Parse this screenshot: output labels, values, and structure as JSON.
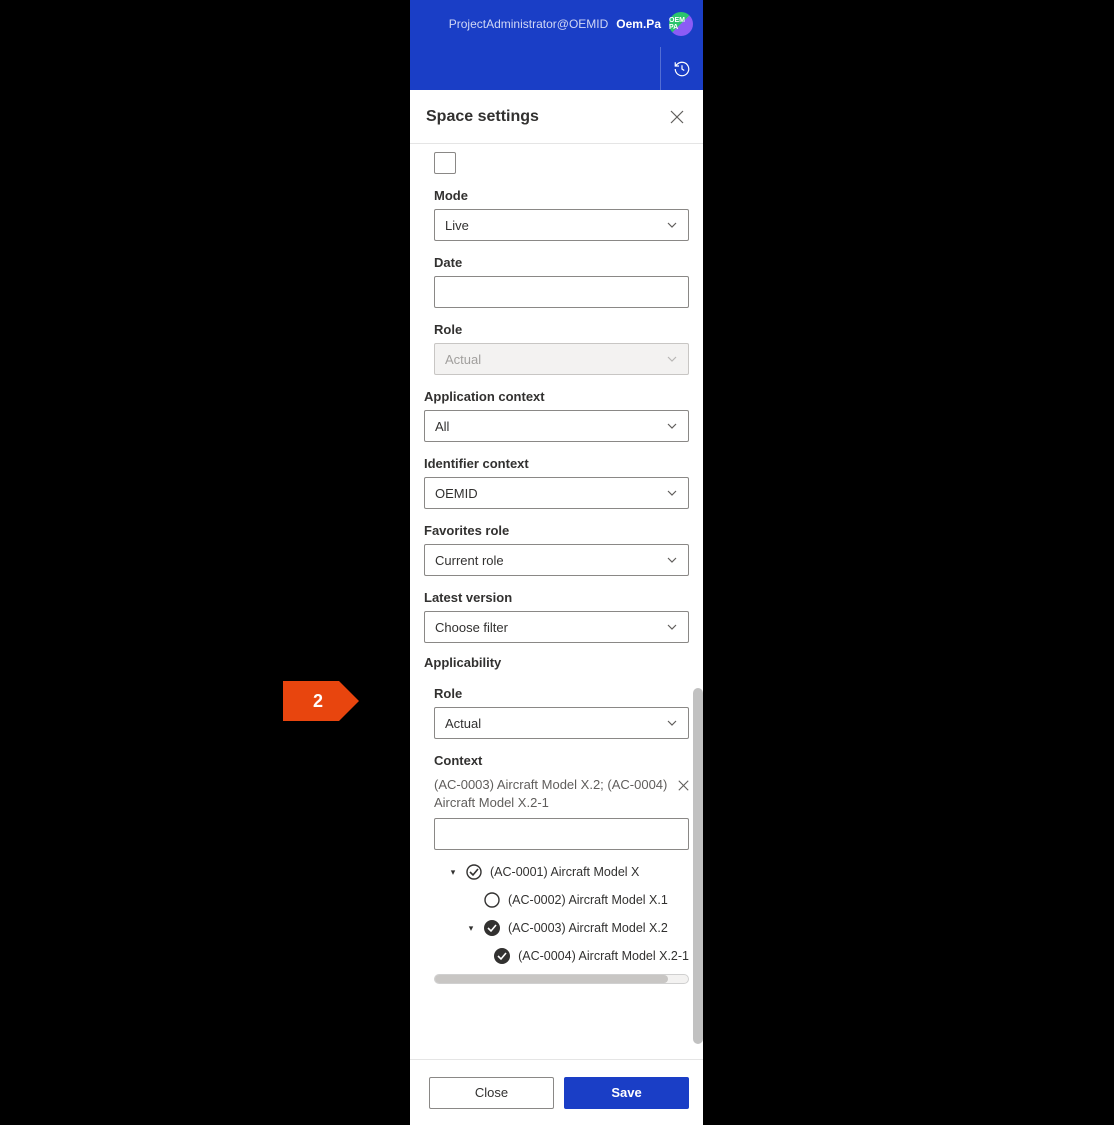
{
  "header": {
    "email": "ProjectAdministrator@OEMID",
    "user": "Oem.Pa",
    "avatar_text": "OEM PA"
  },
  "panel": {
    "title": "Space settings"
  },
  "fields": {
    "mode": {
      "label": "Mode",
      "value": "Live"
    },
    "date": {
      "label": "Date",
      "value": ""
    },
    "role": {
      "label": "Role",
      "value": "Actual"
    },
    "app_context": {
      "label": "Application context",
      "value": "All"
    },
    "id_context": {
      "label": "Identifier context",
      "value": "OEMID"
    },
    "fav_role": {
      "label": "Favorites role",
      "value": "Current role"
    },
    "latest_version": {
      "label": "Latest version",
      "value": "Choose filter"
    }
  },
  "applicability": {
    "heading": "Applicability",
    "role": {
      "label": "Role",
      "value": "Actual"
    },
    "context": {
      "label": "Context",
      "selected_text": "(AC-0003) Aircraft Model X.2; (AC-0004) Aircraft Model X.2-1",
      "input_value": ""
    },
    "tree": [
      {
        "depth": 0,
        "expanded": true,
        "state": "partial",
        "label": "(AC-0001) Aircraft Model X"
      },
      {
        "depth": 1,
        "expanded": null,
        "state": "empty",
        "label": "(AC-0002) Aircraft Model X.1"
      },
      {
        "depth": 1,
        "expanded": true,
        "state": "checked",
        "label": "(AC-0003) Aircraft Model X.2"
      },
      {
        "depth": 2,
        "expanded": null,
        "state": "checked",
        "label": "(AC-0004) Aircraft Model X.2-1"
      }
    ]
  },
  "footer": {
    "close": "Close",
    "save": "Save"
  },
  "callout": {
    "number": "2"
  }
}
